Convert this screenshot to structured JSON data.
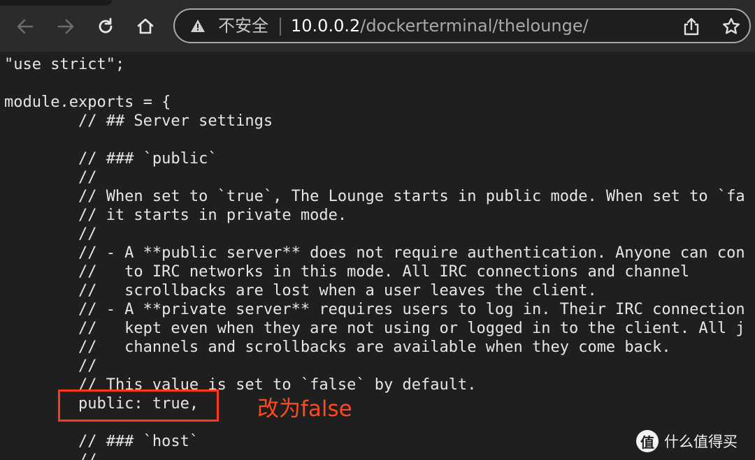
{
  "browser": {
    "security_label": "不安全",
    "url_host": "10.0.0.2",
    "url_path": "/dockerterminal/thelounge/",
    "icons": {
      "back": "arrow-left-icon",
      "forward": "arrow-right-icon",
      "reload": "reload-icon",
      "home": "home-icon",
      "security": "warning-icon",
      "share": "share-icon",
      "bookmark": "star-icon"
    }
  },
  "code": {
    "lines": [
      "\"use strict\";",
      "",
      "module.exports = {",
      "        // ## Server settings",
      "",
      "        // ### `public`",
      "        //",
      "        // When set to `true`, The Lounge starts in public mode. When set to `fa",
      "        // it starts in private mode.",
      "        //",
      "        // - A **public server** does not require authentication. Anyone can con",
      "        //   to IRC networks in this mode. All IRC connections and channel",
      "        //   scrollbacks are lost when a user leaves the client.",
      "        // - A **private server** requires users to log in. Their IRC connection",
      "        //   kept even when they are not using or logged in to the client. All j",
      "        //   channels and scrollbacks are available when they come back.",
      "        //",
      "        // This value is set to `false` by default.",
      "        public: true,",
      "",
      "        // ### `host`",
      "        //"
    ]
  },
  "annotation": {
    "text": "改为false",
    "color": "#ff4a1c"
  },
  "watermark": {
    "logo_char": "值",
    "text": "什么值得买"
  }
}
